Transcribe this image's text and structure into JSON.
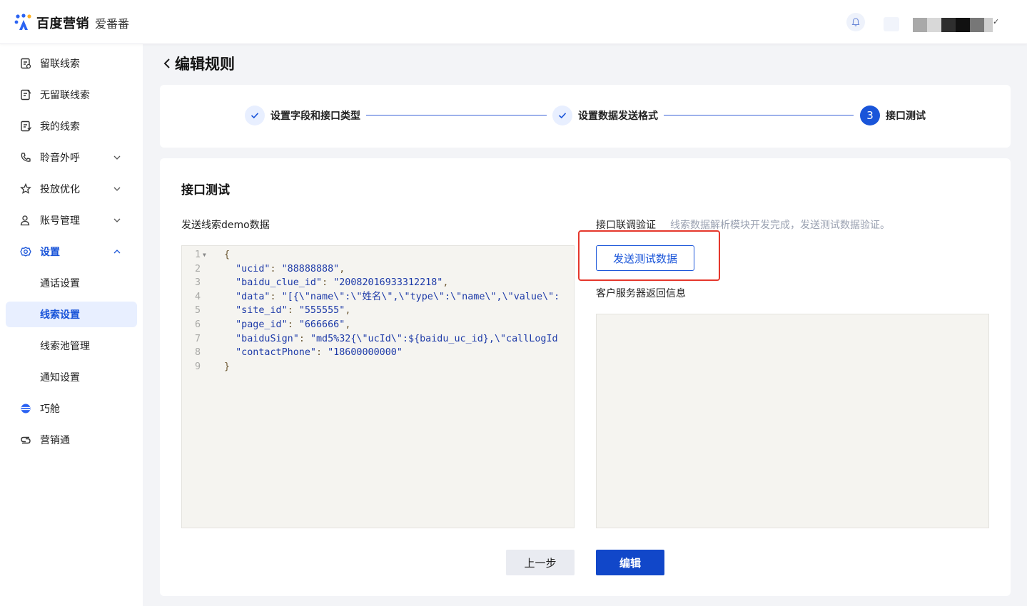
{
  "header": {
    "brand": "百度营销",
    "product": "爱番番"
  },
  "sidebar": {
    "items": [
      {
        "label": "留联线索",
        "icon": "lead-retained-icon"
      },
      {
        "label": "无留联线索",
        "icon": "lead-no-contact-icon"
      },
      {
        "label": "我的线索",
        "icon": "my-leads-icon"
      },
      {
        "label": "聆音外呼",
        "icon": "phone-call-icon"
      },
      {
        "label": "投放优化",
        "icon": "optimize-icon"
      },
      {
        "label": "账号管理",
        "icon": "account-icon"
      },
      {
        "label": "设置",
        "icon": "settings-gear-icon"
      },
      {
        "label": "巧舱",
        "icon": "qiaocang-icon"
      },
      {
        "label": "营销通",
        "icon": "marketing-link-icon"
      }
    ],
    "settings_sub": [
      {
        "label": "通话设置"
      },
      {
        "label": "线索设置"
      },
      {
        "label": "线索池管理"
      },
      {
        "label": "通知设置"
      }
    ]
  },
  "page": {
    "title": "编辑规则"
  },
  "stepper": {
    "steps": [
      {
        "label": "设置字段和接口类型",
        "status": "done"
      },
      {
        "label": "设置数据发送格式",
        "status": "done"
      },
      {
        "label": "接口测试",
        "status": "current",
        "number": "3"
      }
    ]
  },
  "main": {
    "section_title": "接口测试",
    "demo_label": "发送线索demo数据",
    "code_lines": [
      {
        "n": "1",
        "fold": "▼",
        "parts": [
          [
            "p",
            "{"
          ]
        ]
      },
      {
        "n": "2",
        "parts": [
          [
            "p",
            "  "
          ],
          [
            "k",
            "\"ucid\""
          ],
          [
            "p",
            ": "
          ],
          [
            "s",
            "\"88888888\""
          ],
          [
            "p",
            ","
          ]
        ]
      },
      {
        "n": "3",
        "parts": [
          [
            "p",
            "  "
          ],
          [
            "k",
            "\"baidu_clue_id\""
          ],
          [
            "p",
            ": "
          ],
          [
            "s",
            "\"20082016933312218\""
          ],
          [
            "p",
            ","
          ]
        ]
      },
      {
        "n": "4",
        "parts": [
          [
            "p",
            "  "
          ],
          [
            "k",
            "\"data\""
          ],
          [
            "p",
            ": "
          ],
          [
            "s",
            "\"[{\\\"name\\\":\\\"姓名\\\",\\\"type\\\":\\\"name\\\",\\\"value\\\":"
          ]
        ]
      },
      {
        "n": "5",
        "parts": [
          [
            "p",
            "  "
          ],
          [
            "k",
            "\"site_id\""
          ],
          [
            "p",
            ": "
          ],
          [
            "s",
            "\"555555\""
          ],
          [
            "p",
            ","
          ]
        ]
      },
      {
        "n": "6",
        "parts": [
          [
            "p",
            "  "
          ],
          [
            "k",
            "\"page_id\""
          ],
          [
            "p",
            ": "
          ],
          [
            "s",
            "\"666666\""
          ],
          [
            "p",
            ","
          ]
        ]
      },
      {
        "n": "7",
        "parts": [
          [
            "p",
            "  "
          ],
          [
            "k",
            "\"baiduSign\""
          ],
          [
            "p",
            ": "
          ],
          [
            "s",
            "\"md5%32{\\\"ucId\\\":${baidu_uc_id},\\\"callLogId"
          ]
        ]
      },
      {
        "n": "8",
        "parts": [
          [
            "p",
            "  "
          ],
          [
            "k",
            "\"contactPhone\""
          ],
          [
            "p",
            ": "
          ],
          [
            "s",
            "\"18600000000\""
          ]
        ]
      },
      {
        "n": "9",
        "parts": [
          [
            "p",
            "}"
          ]
        ]
      }
    ],
    "verify_label": "接口联调验证",
    "verify_hint": "线索数据解析模块开发完成，发送测试数据验证。",
    "send_button": "发送测试数据",
    "response_label": "客户服务器返回信息",
    "response_text": ""
  },
  "footer_buttons": {
    "prev": "上一步",
    "edit": "编辑"
  },
  "colors": {
    "accent": "#1a55d9",
    "highlight": "#e5372c"
  }
}
